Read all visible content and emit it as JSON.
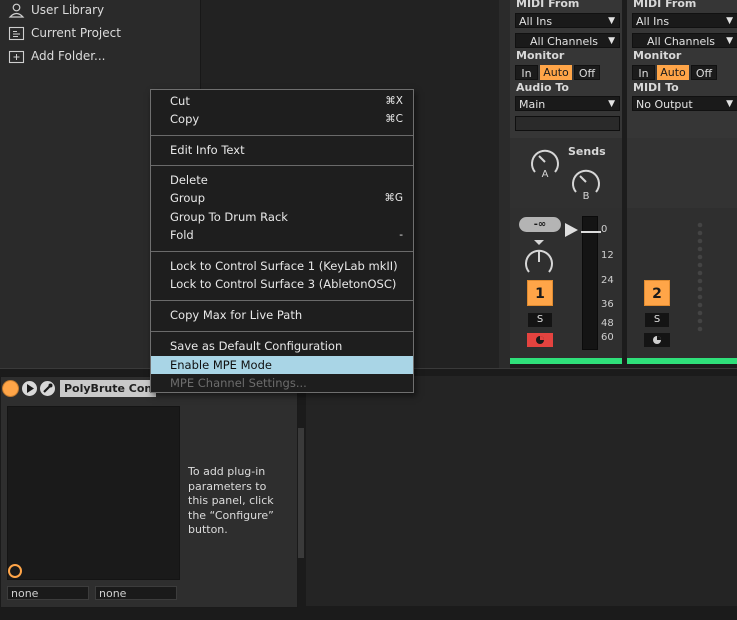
{
  "browser": {
    "items": [
      {
        "label": "User Library",
        "icon": "user-icon"
      },
      {
        "label": "Current Project",
        "icon": "project-icon"
      },
      {
        "label": "Add Folder...",
        "icon": "add-folder-icon"
      }
    ]
  },
  "mixer": {
    "tracks": [
      {
        "midi_from_label": "MIDI From",
        "midi_from": "All Ins",
        "channel": "All Channels",
        "monitor_label": "Monitor",
        "monitor": [
          "In",
          "Auto",
          "Off"
        ],
        "out_label": "Audio To",
        "out_value": "Main",
        "number": "1",
        "solo": "S"
      },
      {
        "midi_from_label": "MIDI From",
        "midi_from": "All Ins",
        "channel": "All Channels",
        "monitor_label": "Monitor",
        "monitor": [
          "In",
          "Auto",
          "Off"
        ],
        "out_label": "MIDI To",
        "out_value": "No Output",
        "number": "2",
        "solo": "S"
      }
    ],
    "sends_label": "Sends",
    "send_knobs": [
      "A",
      "B"
    ],
    "volume_display": "-∞",
    "meter_scale": [
      "0",
      "12",
      "24",
      "36",
      "48",
      "60"
    ],
    "colors": {
      "track_orange": "#ffa548",
      "arm_red": "#e4433f",
      "clip_green": "#2fe07a"
    }
  },
  "device": {
    "title": "PolyBrute Con",
    "hint": "To add plug-in parameters to this panel, click the “Configure” button.",
    "fields": [
      "none",
      "none"
    ]
  },
  "context_menu": {
    "groups": [
      [
        {
          "label": "Cut",
          "shortcut": "⌘X"
        },
        {
          "label": "Copy",
          "shortcut": "⌘C"
        }
      ],
      [
        {
          "label": "Edit Info Text",
          "shortcut": ""
        }
      ],
      [
        {
          "label": "Delete",
          "shortcut": ""
        },
        {
          "label": "Group",
          "shortcut": "⌘G"
        },
        {
          "label": "Group To Drum Rack",
          "shortcut": ""
        },
        {
          "label": "Fold",
          "shortcut": "-"
        }
      ],
      [
        {
          "label": "Lock to Control Surface 1 (KeyLab mkII)",
          "shortcut": ""
        },
        {
          "label": "Lock to Control Surface 3 (AbletonOSC)",
          "shortcut": ""
        }
      ],
      [
        {
          "label": "Copy Max for Live Path",
          "shortcut": ""
        }
      ],
      [
        {
          "label": "Save as Default Configuration",
          "shortcut": ""
        },
        {
          "label": "Enable MPE Mode",
          "shortcut": "",
          "highlighted": true
        },
        {
          "label": "MPE Channel Settings...",
          "shortcut": "",
          "disabled": true
        }
      ]
    ]
  }
}
